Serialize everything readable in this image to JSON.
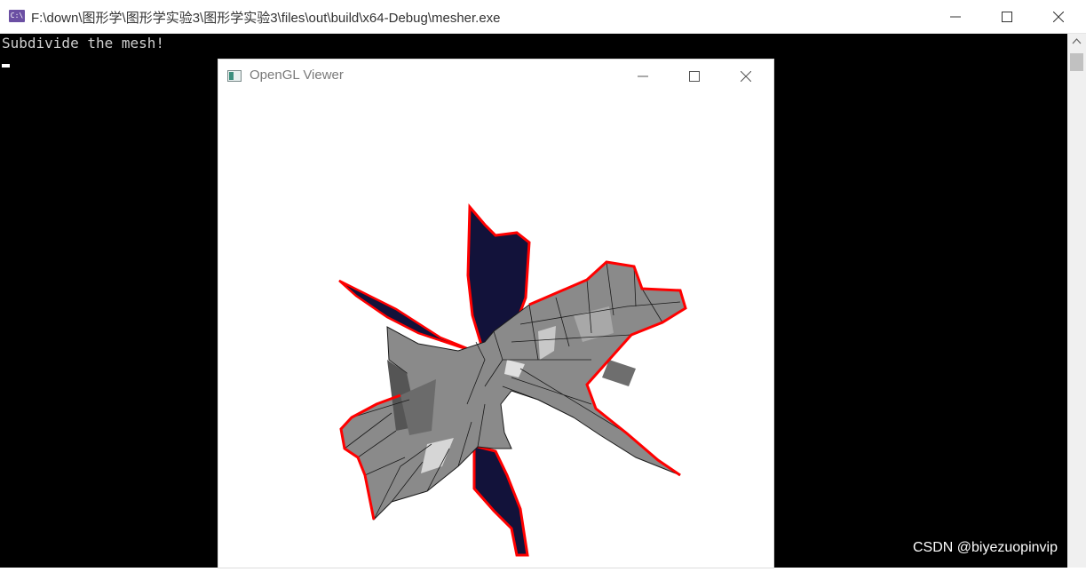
{
  "console": {
    "title": "F:\\down\\图形学\\图形学实验3\\图形学实验3\\files\\out\\build\\x64-Debug\\mesher.exe",
    "icon_text": "C:\\",
    "output_lines": [
      "Subdivide the mesh!"
    ]
  },
  "gl_window": {
    "title": "OpenGL Viewer"
  },
  "watermark": "CSDN @biyezuopinvip",
  "colors": {
    "boundary": "#ff0000",
    "back_faces": "#12123a",
    "front_faces": "#8a8a8a",
    "console_bg": "#000000"
  },
  "icons": [
    "console-app-icon",
    "minimize-icon",
    "maximize-icon",
    "close-icon",
    "opengl-app-icon",
    "scroll-up-arrow-icon"
  ]
}
